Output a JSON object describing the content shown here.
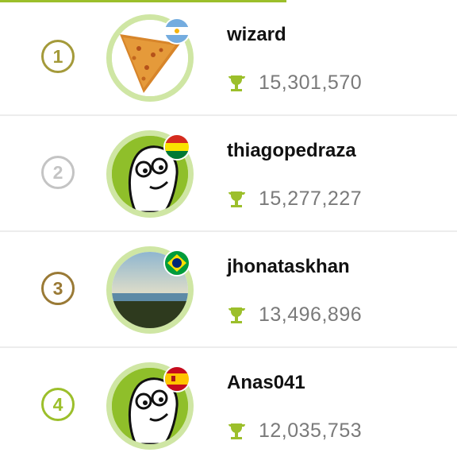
{
  "players": [
    {
      "rank": "1",
      "name": "wizard",
      "score": "15,301,570",
      "rank_color": "#a49a3a",
      "flag": "argentina-flag-icon",
      "avatar": "chip-avatar"
    },
    {
      "rank": "2",
      "name": "thiagopedraza",
      "score": "15,277,227",
      "rank_color": "#c4c4c4",
      "flag": "bolivia-flag-icon",
      "avatar": "doodle-face-avatar"
    },
    {
      "rank": "3",
      "name": "jhonataskhan",
      "score": "13,496,896",
      "rank_color": "#9a7a36",
      "flag": "brazil-flag-icon",
      "avatar": "beach-photo-avatar"
    },
    {
      "rank": "4",
      "name": "Anas041",
      "score": "12,035,753",
      "rank_color": "#9cbf2b",
      "flag": "spain-flag-icon",
      "avatar": "doodle-face-avatar"
    }
  ],
  "colors": {
    "accent": "#9cbf2b",
    "avatar_ring": "#cfe6a4",
    "trophy": "#9cbf2b"
  }
}
